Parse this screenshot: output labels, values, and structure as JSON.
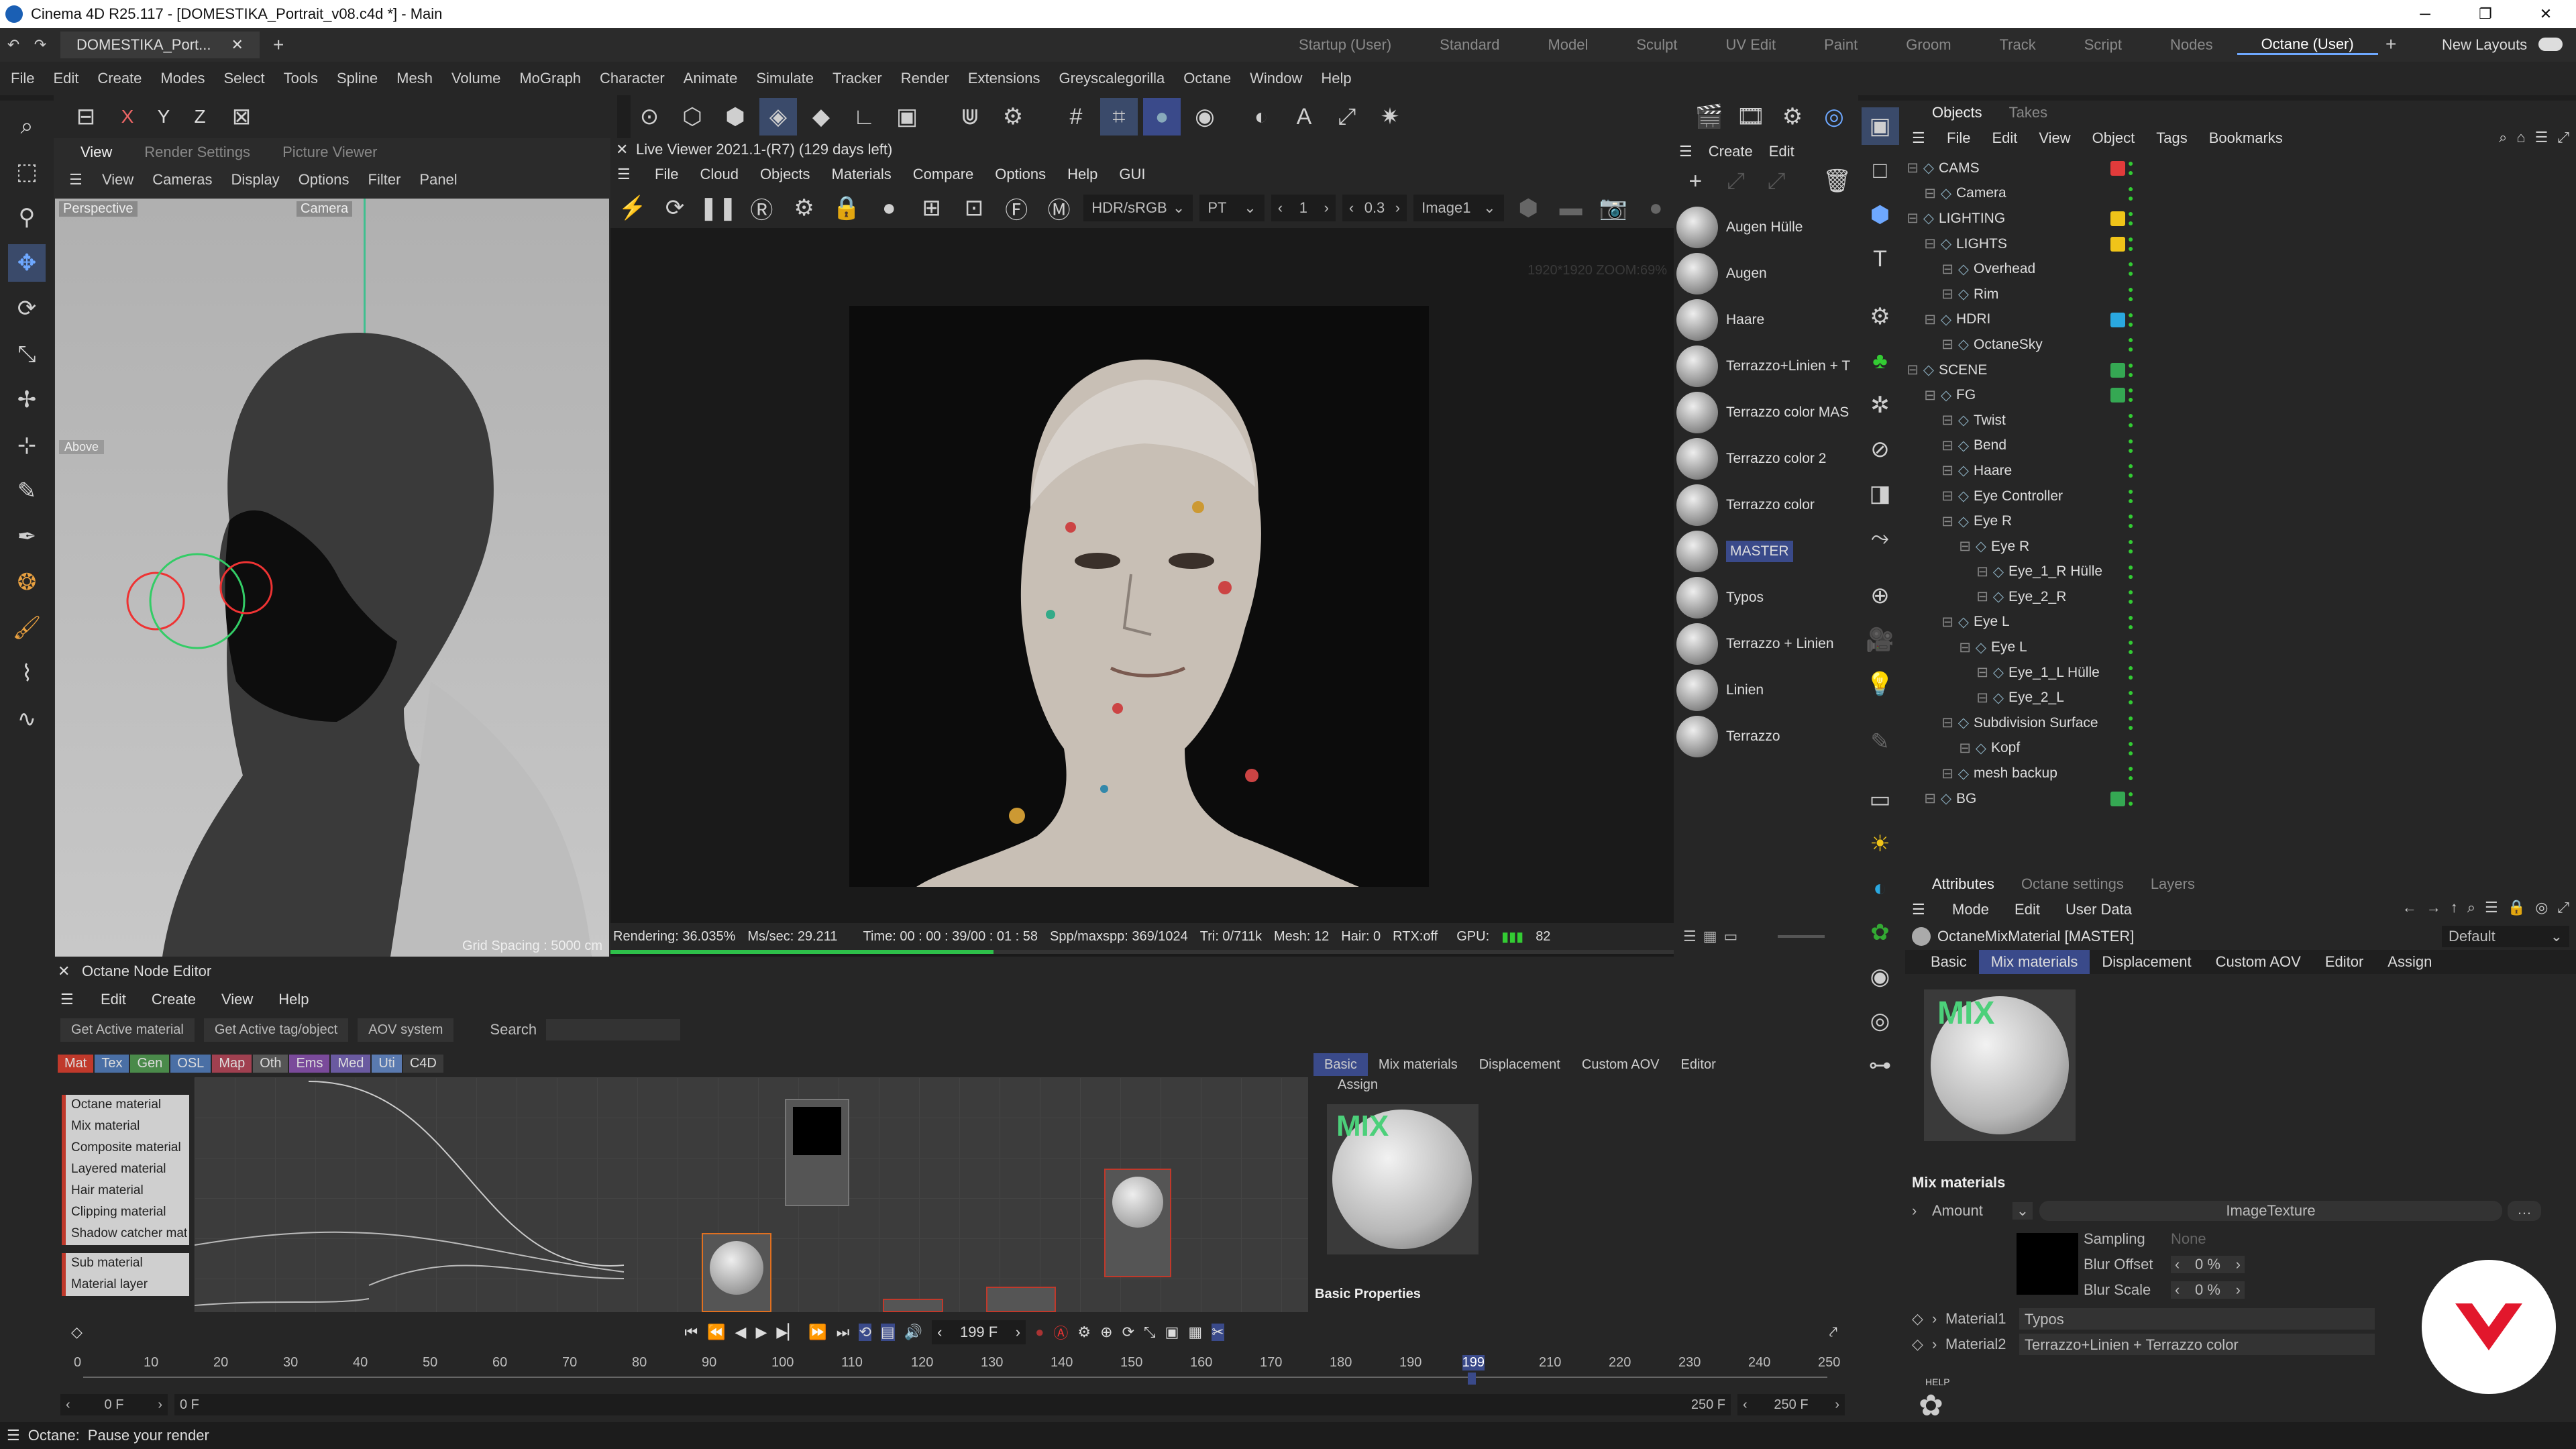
{
  "window": {
    "title": "Cinema 4D R25.117 - [DOMESTIKA_Portrait_v08.c4d *] - Main",
    "doc_tab": "DOMESTIKA_Port..."
  },
  "menu": [
    "File",
    "Edit",
    "Create",
    "Modes",
    "Select",
    "Tools",
    "Spline",
    "Mesh",
    "Volume",
    "MoGraph",
    "Character",
    "Animate",
    "Simulate",
    "Tracker",
    "Render",
    "Extensions",
    "Greyscalegorilla",
    "Octane",
    "Window",
    "Help"
  ],
  "layouts": [
    "Startup (User)",
    "Standard",
    "Model",
    "Sculpt",
    "UV Edit",
    "Paint",
    "Groom",
    "Track",
    "Script",
    "Nodes",
    "Octane (User)"
  ],
  "new_layouts": "New Layouts",
  "axis": [
    "X",
    "Y",
    "Z"
  ],
  "viewport": {
    "tabs": [
      "View",
      "Render Settings",
      "Picture Viewer"
    ],
    "menu": [
      "View",
      "Cameras",
      "Display",
      "Options",
      "Filter",
      "Panel"
    ],
    "label": "Perspective",
    "camera": "Camera",
    "grid": "Grid Spacing : 5000 cm",
    "tag": "Above"
  },
  "live": {
    "title": "Live Viewer 2021.1-(R7) (129 days left)",
    "menu": [
      "File",
      "Cloud",
      "Objects",
      "Materials",
      "Compare",
      "Options",
      "Help",
      "GUI"
    ],
    "colorspace": "HDR/sRGB",
    "kernel": "PT",
    "val1": "1",
    "val2": "0.3",
    "image": "Image1",
    "zoom": "1920*1920 ZOOM:69%"
  },
  "status_render": {
    "rendering": "Rendering: 36.035%",
    "ms": "Ms/sec: 29.211",
    "time": "Time: 00 : 00 : 39/00 : 01 : 58",
    "spp": "Spp/maxspp: 369/1024",
    "tri": "Tri: 0/711k",
    "mesh": "Mesh: 12",
    "hair": "Hair: 0",
    "rtx": "RTX:off",
    "gpu": "GPU:",
    "gpu_val": "82",
    "progress": 0.36
  },
  "materials": {
    "menu": [
      "Create",
      "Edit"
    ],
    "items": [
      "Augen Hülle",
      "Augen",
      "Haare",
      "Terrazzo+Linien + T",
      "Terrazzo color MAS",
      "Terrazzo color 2",
      "Terrazzo color",
      "MASTER",
      "Typos",
      "Terrazzo + Linien",
      "Linien",
      "Terrazzo"
    ]
  },
  "objects": {
    "tabs": [
      "Objects",
      "Takes"
    ],
    "menu": [
      "File",
      "Edit",
      "View",
      "Object",
      "Tags",
      "Bookmarks"
    ],
    "rows": [
      {
        "name": "CAMS",
        "depth": 0,
        "color": "#e23b3b"
      },
      {
        "name": "Camera",
        "depth": 1,
        "color": ""
      },
      {
        "name": "LIGHTING",
        "depth": 0,
        "color": "#f0c419"
      },
      {
        "name": "LIGHTS",
        "depth": 1,
        "color": "#f0c419"
      },
      {
        "name": "Overhead",
        "depth": 2,
        "color": ""
      },
      {
        "name": "Rim",
        "depth": 2,
        "color": ""
      },
      {
        "name": "HDRI",
        "depth": 1,
        "color": "#2aa8e0"
      },
      {
        "name": "OctaneSky",
        "depth": 2,
        "color": ""
      },
      {
        "name": "SCENE",
        "depth": 0,
        "color": "#35a853"
      },
      {
        "name": "FG",
        "depth": 1,
        "color": "#35a853"
      },
      {
        "name": "Twist",
        "depth": 2,
        "color": ""
      },
      {
        "name": "Bend",
        "depth": 2,
        "color": ""
      },
      {
        "name": "Haare",
        "depth": 2,
        "color": ""
      },
      {
        "name": "Eye Controller",
        "depth": 2,
        "color": ""
      },
      {
        "name": "Eye R",
        "depth": 2,
        "color": ""
      },
      {
        "name": "Eye R",
        "depth": 3,
        "color": ""
      },
      {
        "name": "Eye_1_R Hülle",
        "depth": 4,
        "color": ""
      },
      {
        "name": "Eye_2_R",
        "depth": 4,
        "color": ""
      },
      {
        "name": "Eye L",
        "depth": 2,
        "color": ""
      },
      {
        "name": "Eye L",
        "depth": 3,
        "color": ""
      },
      {
        "name": "Eye_1_L Hülle",
        "depth": 4,
        "color": ""
      },
      {
        "name": "Eye_2_L",
        "depth": 4,
        "color": ""
      },
      {
        "name": "Subdivision Surface",
        "depth": 2,
        "color": ""
      },
      {
        "name": "Kopf",
        "depth": 3,
        "color": ""
      },
      {
        "name": "mesh backup",
        "depth": 2,
        "color": ""
      },
      {
        "name": "BG",
        "depth": 1,
        "color": "#35a853"
      }
    ]
  },
  "attributes": {
    "tabs": [
      "Attributes",
      "Octane settings",
      "Layers"
    ],
    "menu": [
      "Mode",
      "Edit",
      "User Data"
    ],
    "object": "OctaneMixMaterial [MASTER]",
    "preset": "Default",
    "subtabs": [
      "Basic",
      "Mix materials",
      "Displacement",
      "Custom AOV",
      "Editor",
      "Assign"
    ],
    "mix_label": "MIX",
    "section": "Mix materials",
    "amount": "Amount",
    "texture": "ImageTexture",
    "sampling": "Sampling",
    "sampling_val": "None",
    "blur_offset": "Blur Offset",
    "blur_offset_val": "0 %",
    "blur_scale": "Blur Scale",
    "blur_scale_val": "0 %",
    "m1": "Material1",
    "m1_val": "Typos",
    "m2": "Material2",
    "m2_val": "Terrazzo+Linien + Terrazzo color",
    "help": "HELP"
  },
  "node_editor": {
    "title": "Octane Node Editor",
    "menu": [
      "Edit",
      "Create",
      "View",
      "Help"
    ],
    "buttons": [
      "Get Active material",
      "Get Active tag/object",
      "AOV system"
    ],
    "search": "Search",
    "cats": [
      {
        "t": "Mat",
        "c": "#c0392b"
      },
      {
        "t": "Tex",
        "c": "#4a6fa5"
      },
      {
        "t": "Gen",
        "c": "#4a8a4a"
      },
      {
        "t": "OSL",
        "c": "#4a6fa5"
      },
      {
        "t": "Map",
        "c": "#a04050"
      },
      {
        "t": "Oth",
        "c": "#555"
      },
      {
        "t": "Ems",
        "c": "#7a4a9a"
      },
      {
        "t": "Med",
        "c": "#6a5aa0"
      },
      {
        "t": "Uti",
        "c": "#5a7ab0"
      },
      {
        "t": "C4D",
        "c": "#3a3a3a"
      }
    ],
    "list": [
      "Octane material",
      "Mix material",
      "Composite material",
      "Layered material",
      "Hair material",
      "Clipping material",
      "Shadow catcher mat",
      "Sub material",
      "Material layer"
    ],
    "tabs": [
      "Basic",
      "Mix materials",
      "Displacement",
      "Custom AOV",
      "Editor"
    ],
    "assign": "Assign",
    "basic_props": "Basic Properties",
    "mix_label": "MIX"
  },
  "timeline": {
    "frame": "199 F",
    "ticks": [
      "0",
      "10",
      "20",
      "30",
      "40",
      "50",
      "60",
      "70",
      "80",
      "90",
      "100",
      "110",
      "120",
      "130",
      "140",
      "150",
      "160",
      "170",
      "180",
      "190",
      "199",
      "210",
      "220",
      "230",
      "240",
      "250"
    ],
    "start": "0 F",
    "start2": "0 F",
    "end": "250 F",
    "end2": "250 F",
    "current": 199,
    "max": 250
  },
  "status": {
    "app": "Octane:",
    "msg": "Pause your render"
  }
}
